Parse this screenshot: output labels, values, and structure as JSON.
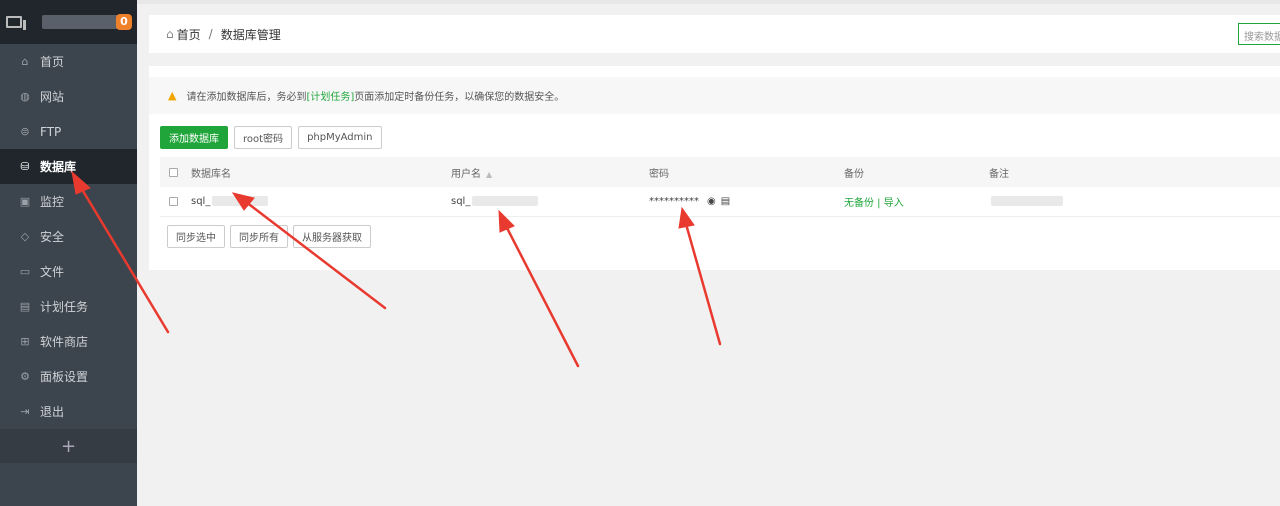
{
  "sidebar": {
    "badge": "0",
    "items": [
      {
        "label": "首页",
        "icon": "home-icon",
        "glyph": "⌂"
      },
      {
        "label": "网站",
        "icon": "globe-icon",
        "glyph": "◍"
      },
      {
        "label": "FTP",
        "icon": "ftp-icon",
        "glyph": "⊜"
      },
      {
        "label": "数据库",
        "icon": "database-icon",
        "glyph": "⛁"
      },
      {
        "label": "监控",
        "icon": "monitor-icon",
        "glyph": "▣"
      },
      {
        "label": "安全",
        "icon": "shield-icon",
        "glyph": "◇"
      },
      {
        "label": "文件",
        "icon": "folder-icon",
        "glyph": "▭"
      },
      {
        "label": "计划任务",
        "icon": "calendar-icon",
        "glyph": "▤"
      },
      {
        "label": "软件商店",
        "icon": "apps-icon",
        "glyph": "⊞"
      },
      {
        "label": "面板设置",
        "icon": "gear-icon",
        "glyph": "⚙"
      },
      {
        "label": "退出",
        "icon": "logout-icon",
        "glyph": "⇥"
      }
    ],
    "add_label": "+"
  },
  "breadcrumb": {
    "home": "首页",
    "separator": "/",
    "current": "数据库管理"
  },
  "search": {
    "placeholder": "搜索数据库"
  },
  "notice": {
    "before": "请在添加数据库后，务必到",
    "link": "[计划任务]",
    "after": "页面添加定时备份任务，以确保您的数据安全。"
  },
  "toolbar": {
    "add_db": "添加数据库",
    "root_pwd": "root密码",
    "phpmyadmin": "phpMyAdmin"
  },
  "table": {
    "headers": {
      "name": "数据库名",
      "user": "用户名",
      "password": "密码",
      "backup": "备份",
      "remark": "备注"
    },
    "rows": [
      {
        "name": "sql_",
        "user": "sql_",
        "password": "**********",
        "backup_none": "无备份",
        "backup_sep": " | ",
        "import": "导入"
      }
    ]
  },
  "bottom_buttons": {
    "sync_selected": "同步选中",
    "sync_all": "同步所有",
    "fetch_server": "从服务器获取"
  },
  "colors": {
    "accent": "#20a53a",
    "annotation": "#e83a2f",
    "sidebar_bg": "#3c444d"
  }
}
